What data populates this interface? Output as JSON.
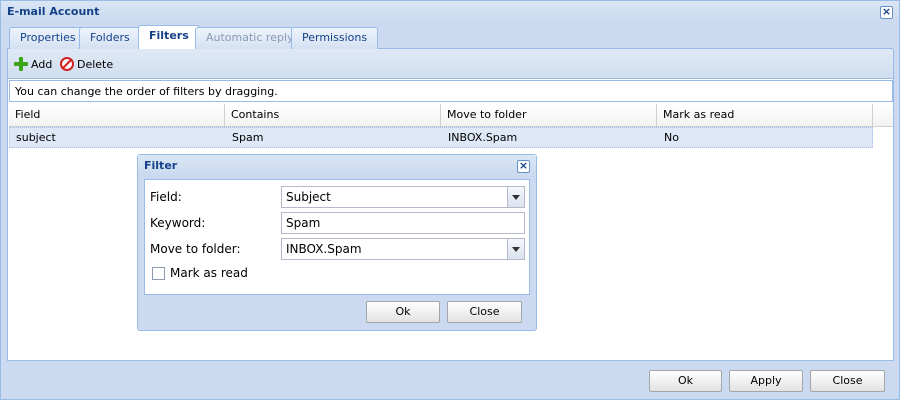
{
  "window": {
    "title": "E-mail Account"
  },
  "tabs": [
    {
      "label": "Properties"
    },
    {
      "label": "Folders"
    },
    {
      "label": "Filters"
    },
    {
      "label": "Automatic reply"
    },
    {
      "label": "Permissions"
    }
  ],
  "toolbar": {
    "add_label": "Add",
    "delete_label": "Delete"
  },
  "info_text": "You can change the order of filters by dragging.",
  "grid": {
    "columns": [
      "Field",
      "Contains",
      "Move to folder",
      "Mark as read"
    ],
    "rows": [
      [
        "subject",
        "Spam",
        "INBOX.Spam",
        "No"
      ]
    ]
  },
  "dialog": {
    "title": "Filter",
    "field_label": "Field:",
    "field_value": "Subject",
    "keyword_label": "Keyword:",
    "keyword_value": "Spam",
    "folder_label": "Move to folder:",
    "folder_value": "INBOX.Spam",
    "mark_read_label": "Mark as read",
    "ok_label": "Ok",
    "close_label": "Close"
  },
  "footer": {
    "ok_label": "Ok",
    "apply_label": "Apply",
    "close_label": "Close"
  }
}
